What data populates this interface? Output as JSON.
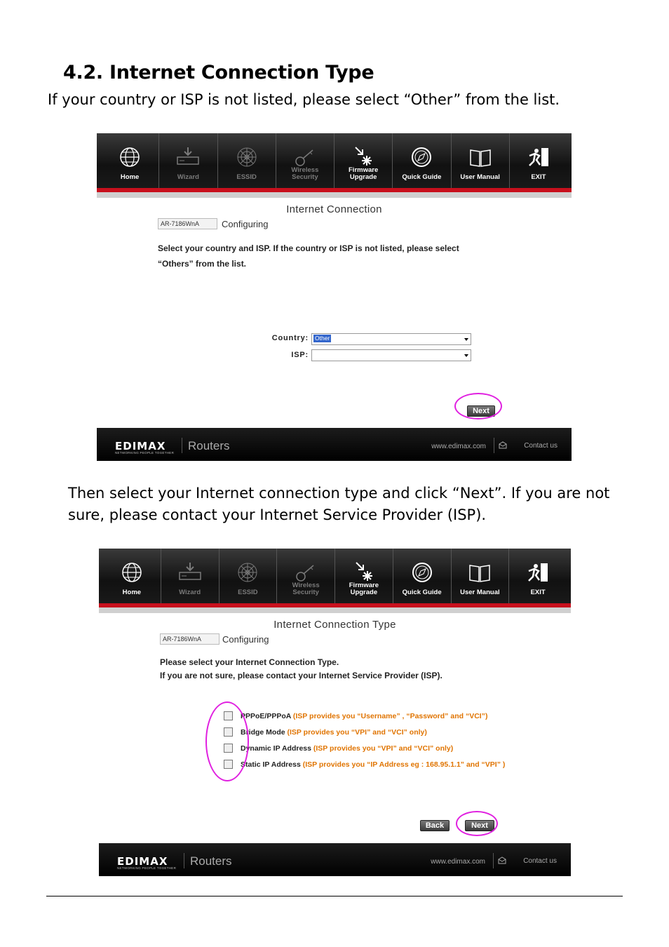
{
  "heading": "4.2. Internet Connection Type",
  "para1": "If your country or ISP is not listed, please select “Other” from the list.",
  "para2": "Then select your Internet connection type and click “Next”.  If you are not sure, please contact your Internet Service Provider (ISP).",
  "nav": [
    {
      "label_line1": "",
      "label_line2": "Home",
      "icon": "globe-icon",
      "dim": false
    },
    {
      "label_line1": "",
      "label_line2": "Wizard",
      "icon": "router-icon",
      "dim": true
    },
    {
      "label_line1": "",
      "label_line2": "ESSID",
      "icon": "web-icon",
      "dim": true
    },
    {
      "label_line1": "Wireless",
      "label_line2": "Security",
      "icon": "key-icon",
      "dim": true
    },
    {
      "label_line1": "Firmware",
      "label_line2": "Upgrade",
      "icon": "firmware-icon",
      "dim": false
    },
    {
      "label_line1": "",
      "label_line2": "Quick Guide",
      "icon": "compass-icon",
      "dim": false
    },
    {
      "label_line1": "",
      "label_line2": "User Manual",
      "icon": "book-icon",
      "dim": false
    },
    {
      "label_line1": "",
      "label_line2": "EXIT",
      "icon": "exit-icon",
      "dim": false
    }
  ],
  "screen1": {
    "title": "Internet Connection",
    "model": "AR-7186WnA",
    "status": "Configuring",
    "instruction_line1": "Select your country and ISP. If the country or ISP is not listed, please select",
    "instruction_line2": "“Others” from the list.",
    "country_label": "Country:",
    "country_value": "Other",
    "isp_label": "ISP:",
    "isp_value": "",
    "next_label": "Next"
  },
  "screen2": {
    "title": "Internet Connection Type",
    "model": "AR-7186WnA",
    "status": "Configuring",
    "instruction_line1": "Please select your Internet Connection Type.",
    "instruction_line2": "If you are not sure, please contact your Internet Service Provider (ISP).",
    "options": [
      {
        "name": "PPPoE/PPPoA",
        "hint": "(ISP provides you “Username” , “Password” and “VCI”)"
      },
      {
        "name": "Bridge Mode",
        "hint": "(ISP provides you “VPI” and “VCI” only)"
      },
      {
        "name": "Dynamic IP Address",
        "hint": "(ISP provides you “VPI” and “VCI” only)"
      },
      {
        "name": "Static IP Address",
        "hint": "(ISP provides you “IP Address eg : 168.95.1.1” and “VPI” )"
      }
    ],
    "back_label": "Back",
    "next_label": "Next"
  },
  "footer": {
    "brand": "EDIMAX",
    "tagline": "NETWORKING PEOPLE TOGETHER",
    "product": "Routers",
    "url": "www.edimax.com",
    "contact": "Contact us"
  },
  "colors": {
    "accent_red": "#c8101d",
    "highlight_circle": "#e020e0",
    "hint_orange": "#e07400"
  }
}
